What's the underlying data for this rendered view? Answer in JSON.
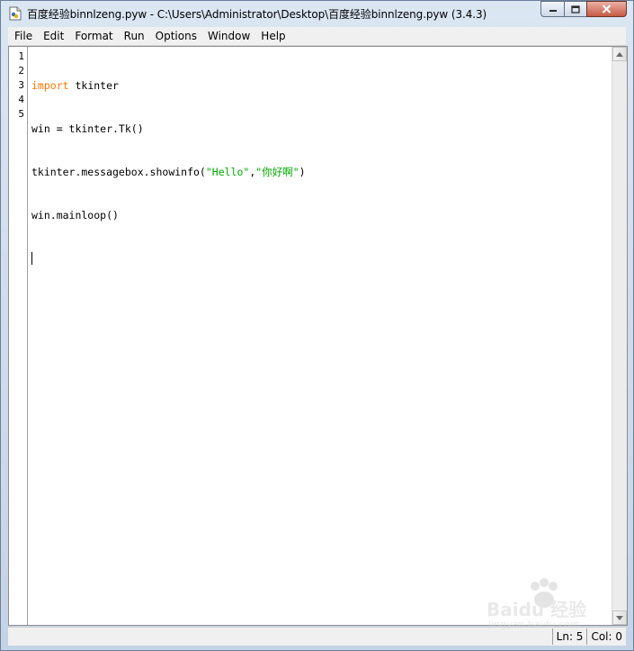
{
  "window": {
    "title": "百度经验binnlzeng.pyw - C:\\Users\\Administrator\\Desktop\\百度经验binnlzeng.pyw (3.4.3)"
  },
  "menu": {
    "items": [
      "File",
      "Edit",
      "Format",
      "Run",
      "Options",
      "Window",
      "Help"
    ]
  },
  "editor": {
    "line_numbers": [
      "1",
      "2",
      "3",
      "4",
      "5"
    ],
    "lines": {
      "l1_kw": "import",
      "l1_rest": " tkinter",
      "l2": "win = tkinter.Tk()",
      "l3_a": "tkinter.messagebox.showinfo(",
      "l3_s1": "\"Hello\"",
      "l3_comma": ",",
      "l3_s2": "\"你好啊\"",
      "l3_b": ")",
      "l4": "win.mainloop()",
      "l5": ""
    },
    "syntax_colors": {
      "keyword": "#ff7700",
      "string": "#00aa00"
    }
  },
  "status": {
    "line": "Ln: 5",
    "col": "Col: 0"
  },
  "watermark": {
    "main": "Baidu 经验",
    "sub": "jingyan.baidu.com"
  },
  "icons": {
    "app": "python-file-icon",
    "minimize": "minimize-icon",
    "maximize": "maximize-icon",
    "close": "close-icon",
    "scroll_up": "chevron-up-icon",
    "scroll_down": "chevron-down-icon"
  }
}
